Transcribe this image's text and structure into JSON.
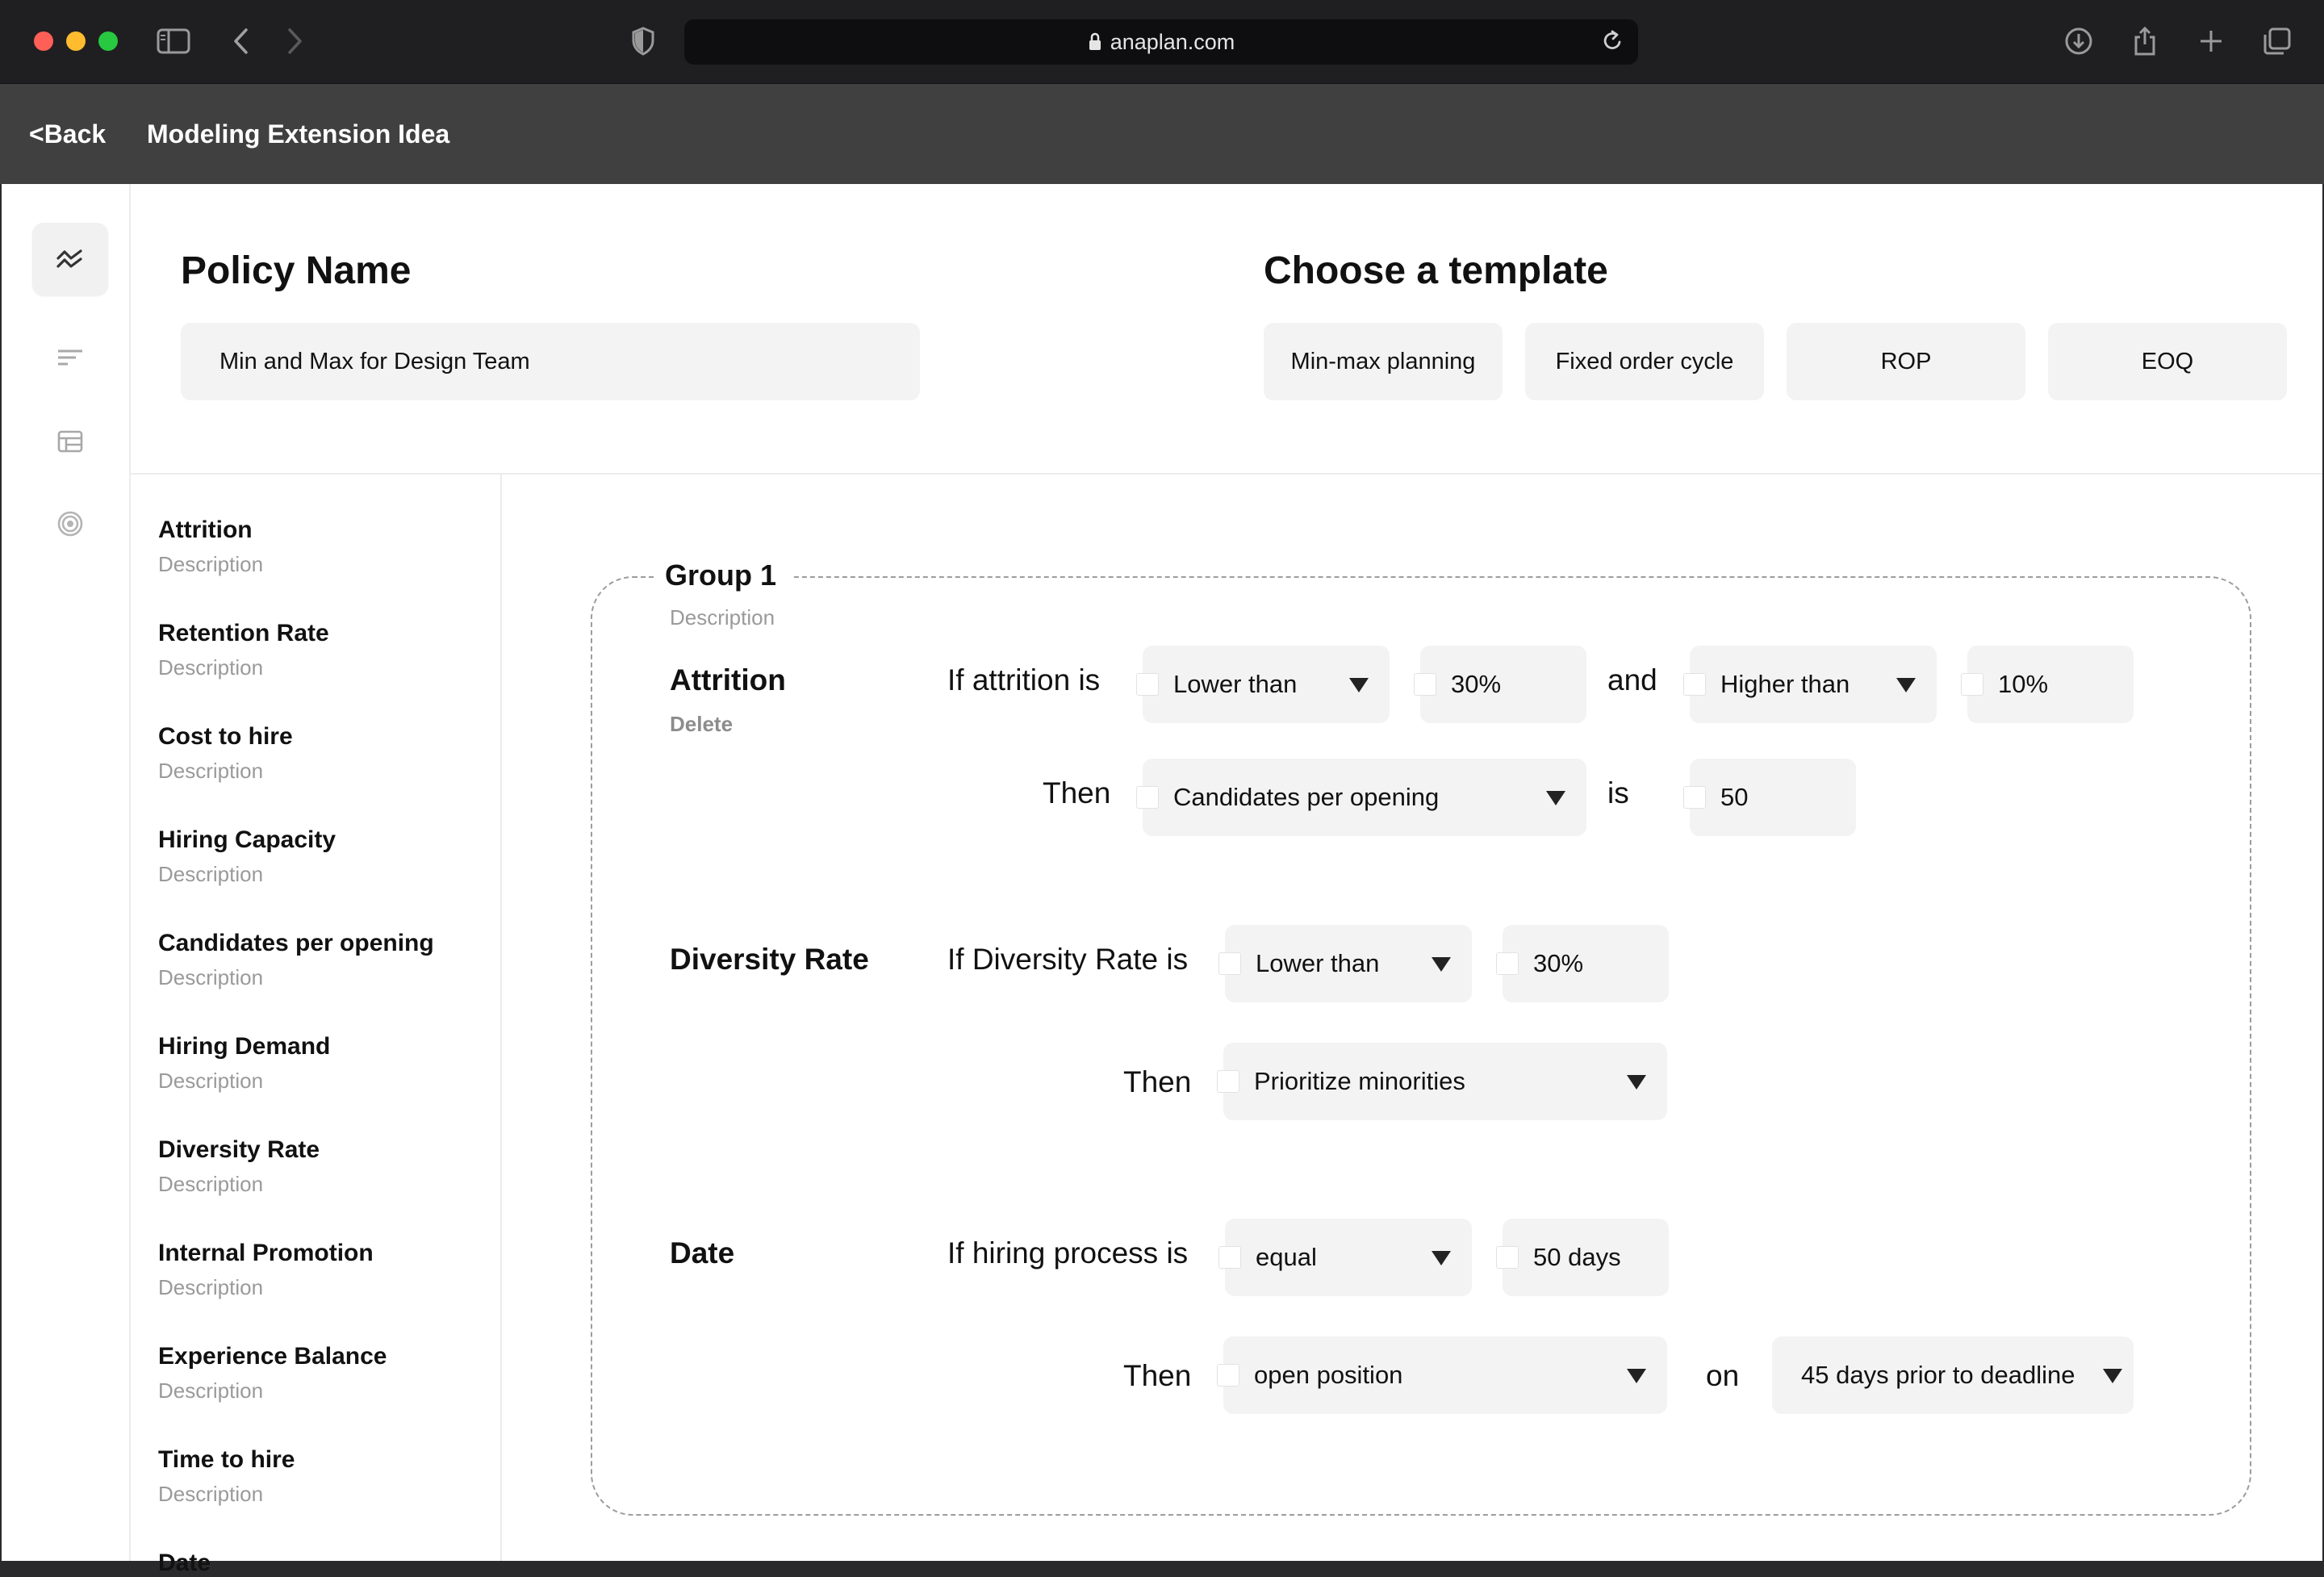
{
  "browser": {
    "url": "anaplan.com"
  },
  "app": {
    "back_label": "<Back",
    "title": "Modeling Extension Idea"
  },
  "rail": {
    "icons": [
      "trend-icon",
      "sort-lines-icon",
      "table-icon",
      "target-icon"
    ],
    "active_index": 0
  },
  "policy": {
    "heading": "Policy Name",
    "value": "Min and Max for Design Team"
  },
  "template": {
    "heading": "Choose a template",
    "options": [
      "Min-max planning",
      "Fixed order cycle",
      "ROP",
      "EOQ"
    ]
  },
  "parameters": [
    {
      "name": "Attrition",
      "description": "Description"
    },
    {
      "name": "Retention Rate",
      "description": "Description"
    },
    {
      "name": "Cost to hire",
      "description": "Description"
    },
    {
      "name": "Hiring Capacity",
      "description": "Description"
    },
    {
      "name": "Candidates per opening",
      "description": "Description"
    },
    {
      "name": "Hiring Demand",
      "description": "Description"
    },
    {
      "name": "Diversity Rate",
      "description": "Description"
    },
    {
      "name": "Internal Promotion",
      "description": "Description"
    },
    {
      "name": "Experience Balance",
      "description": "Description"
    },
    {
      "name": "Time to hire",
      "description": "Description"
    },
    {
      "name": "Date",
      "description": ""
    }
  ],
  "group": {
    "name": "Group 1",
    "description": "Description",
    "rules": [
      {
        "name": "Attrition",
        "delete_label": "Delete",
        "if_text": "If attrition is",
        "condition1": "Lower than",
        "value1": "30%",
        "connector": "and",
        "condition2": "Higher than",
        "value2": "10%",
        "then_text": "Then",
        "action": "Candidates per opening",
        "is_text": "is",
        "action_value": "50"
      },
      {
        "name": "Diversity Rate",
        "if_text": "If Diversity Rate is",
        "condition1": "Lower than",
        "value1": "30%",
        "then_text": "Then",
        "action": "Prioritize minorities"
      },
      {
        "name": "Date",
        "if_text": "If hiring process is",
        "condition1": "equal",
        "value1": "50 days",
        "then_text": "Then",
        "action": "open position",
        "on_text": "on",
        "timing": "45 days prior to deadline"
      }
    ]
  }
}
